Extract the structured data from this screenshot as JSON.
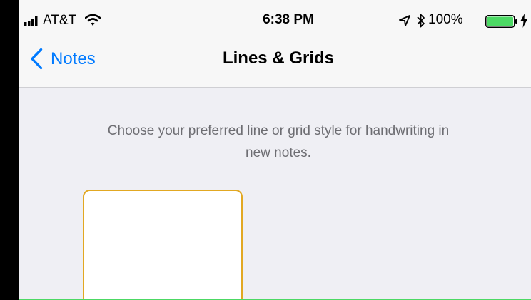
{
  "status_bar": {
    "carrier": "AT&T",
    "time": "6:38 PM",
    "battery_percent": "100%",
    "battery_level": 1.0,
    "icons": [
      "signal-icon",
      "wifi-icon",
      "location-icon",
      "bluetooth-icon",
      "battery-icon",
      "charging-icon"
    ]
  },
  "nav": {
    "back_label": "Notes",
    "title": "Lines & Grids",
    "back_icon": "chevron-left-icon"
  },
  "content": {
    "description": "Choose your preferred line or grid style for handwriting in new notes.",
    "options": [
      {
        "name": "blank",
        "selected": true
      }
    ]
  },
  "colors": {
    "accent": "#007aff",
    "selection": "#e2a822",
    "background": "#efeff4",
    "nav_background": "#f7f7f7",
    "bottom_accent": "#4cd964"
  }
}
